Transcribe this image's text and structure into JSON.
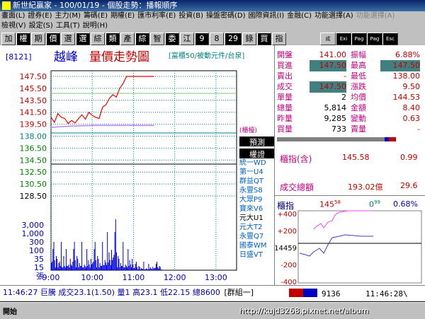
{
  "window": {
    "title": "新世紀贏家 - 100/01/19 - 個股走勢：播報順序"
  },
  "menu": {
    "row1": [
      "畫面(L)",
      "證券(E)",
      "主力(M)",
      "籌碼(E)",
      "期權(E)",
      "匯市利率(E)",
      "投資(B)",
      "操盤密碼(D)",
      "國際資訊(I)",
      "金融(C)",
      "功能選擇(A)",
      "功能選擇(A)"
    ],
    "row2": [
      "檢視(V)",
      "設定(S)",
      "工具(T)",
      "說明(H)"
    ]
  },
  "toolbar": {
    "buttons": [
      "加",
      "權",
      "期",
      "價",
      "選",
      "選",
      "綜",
      "類",
      "產",
      "綜",
      "智",
      "委",
      "江",
      "9",
      "8",
      "29",
      "錄",
      "買",
      "指"
    ],
    "right": [
      "成",
      "Exi",
      "Pag",
      "Pag",
      "Esc"
    ]
  },
  "stock": {
    "code": "[8121]",
    "name": "越峰",
    "chart_title": "量價走勢圖",
    "subtitle": "[富櫃50/被動元件/台泉]"
  },
  "price_axis": [
    "147.50",
    "145.50",
    "143.50",
    "141.50",
    "139.50",
    "138.00",
    "136.50",
    "134.50",
    "132.50",
    "130.50",
    "128.50"
  ],
  "vol_axis": [
    "3,000",
    "1,000",
    "300",
    "100",
    "35",
    "15",
    "張"
  ],
  "time_axis": [
    "9:00",
    "10:00",
    "11:00",
    "12:00",
    "13:00"
  ],
  "broker_list": {
    "header1": "(櫃檯)",
    "btn1": "預測",
    "btn2": "權證",
    "items": [
      "統一WD",
      "第一U4",
      "群益QT",
      "永豐S8",
      "大眾P9",
      "寶來V6",
      "元大U1",
      "元大T2",
      "永豐Q7",
      "國泰WM",
      "日盛VT"
    ]
  },
  "quote": {
    "open_lbl": "開盤",
    "open": "141.00",
    "amp_lbl": "振幅",
    "amp": "6.88%",
    "bid_lbl": "買進",
    "bid": "147.50",
    "high_lbl": "最高",
    "high": "147.50",
    "ask_lbl": "賣出",
    "ask": "-",
    "low_lbl": "最低",
    "low": "138.00",
    "deal_lbl": "成交",
    "deal": "147.50",
    "chg_lbl": "漲跌",
    "chg": "9.50",
    "qty_lbl": "單量",
    "qty": "2",
    "avg_lbl": "均價",
    "avg": "144.53",
    "tvol_lbl": "總量",
    "tvol": "5,814",
    "amt_lbl": "金額",
    "amt": "8.40",
    "yvol_lbl": "昨量",
    "yvol": "9,285",
    "vchg_lbl": "變動",
    "vchg": "0.63",
    "buyvol_lbl": "買量",
    "buyvol": "733",
    "sellvol_lbl": "賣量",
    "sellvol": "-"
  },
  "otc": {
    "label": "櫃指(含)",
    "value": "145.58",
    "chg": "0.99",
    "total_lbl": "成交總額",
    "total": "193.02億",
    "total_chg": "29.6"
  },
  "mini": {
    "label": "櫃指",
    "value": "145",
    "value_sup": "58",
    "chg": "0",
    "chg_sup": "99",
    "pct": "0.68%",
    "axis": [
      "+400",
      "+200",
      "14459",
      "-200",
      "-400"
    ]
  },
  "status": {
    "text": "11:46:27 巨騰 成交23.1(1.50) 量1 高23.1 低22.15 總8600",
    "group": "[群組一]",
    "code": "9136",
    "time": "11:46:28\\"
  },
  "taskbar": {
    "start": "開始",
    "url": "http://kujd3268.pixnet.net/album"
  },
  "chart_data": {
    "type": "line",
    "price_series": [
      [
        0,
        141.0
      ],
      [
        5,
        140.2
      ],
      [
        10,
        141.6
      ],
      [
        15,
        141.0
      ],
      [
        20,
        140.8
      ],
      [
        25,
        140.0
      ],
      [
        30,
        140.5
      ],
      [
        35,
        140.1
      ],
      [
        40,
        140.8
      ],
      [
        45,
        141.4
      ],
      [
        50,
        140.7
      ],
      [
        55,
        141.8
      ],
      [
        60,
        141.3
      ],
      [
        65,
        141.0
      ],
      [
        70,
        140.8
      ],
      [
        75,
        142.6
      ],
      [
        80,
        143.0
      ],
      [
        85,
        144.0
      ],
      [
        90,
        144.6
      ],
      [
        95,
        144.2
      ],
      [
        100,
        145.6
      ],
      [
        105,
        146.4
      ],
      [
        110,
        147.5
      ],
      [
        120,
        147.5
      ],
      [
        150,
        147.5
      ]
    ],
    "avg_series": [
      [
        0,
        139.4
      ],
      [
        30,
        139.6
      ],
      [
        60,
        139.7
      ],
      [
        90,
        139.7
      ],
      [
        150,
        139.7
      ]
    ],
    "ref_price": 138.0,
    "ylim": [
      128.5,
      147.5
    ],
    "xlim_minutes": [
      0,
      270
    ]
  }
}
